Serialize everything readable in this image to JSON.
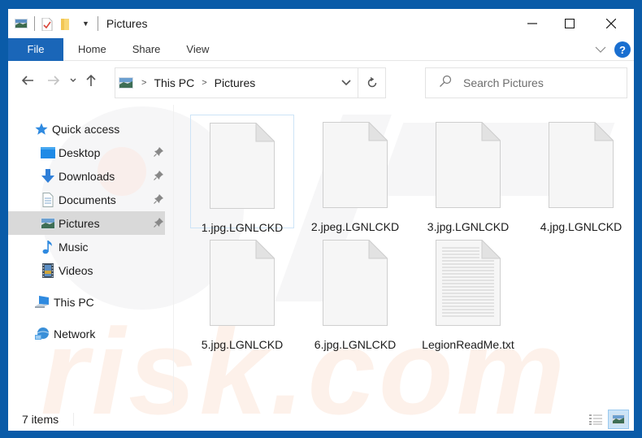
{
  "window": {
    "title": "Pictures",
    "controls": {
      "minimize": "minimize",
      "maximize": "maximize",
      "close": "close"
    }
  },
  "quick_access_toolbar": {
    "icons": [
      "pictures-folder-icon",
      "properties-icon",
      "new-folder-icon",
      "customize-dropdown-icon"
    ]
  },
  "ribbon": {
    "file_label": "File",
    "tabs": [
      "Home",
      "Share",
      "View"
    ],
    "expand_icon": "chevron-down-icon",
    "help_label": "?"
  },
  "navigation": {
    "back_icon": "arrow-left-icon",
    "forward_icon": "arrow-right-icon",
    "recent_icon": "chevron-down-icon",
    "up_icon": "arrow-up-icon",
    "breadcrumb": [
      "This PC",
      "Pictures"
    ],
    "refresh_icon": "refresh-icon"
  },
  "search": {
    "placeholder": "Search Pictures",
    "value": ""
  },
  "sidebar": {
    "quick_access": "Quick access",
    "items": [
      {
        "label": "Desktop",
        "pinned": true
      },
      {
        "label": "Downloads",
        "pinned": true
      },
      {
        "label": "Documents",
        "pinned": true
      },
      {
        "label": "Pictures",
        "pinned": true,
        "selected": true
      },
      {
        "label": "Music",
        "pinned": false
      },
      {
        "label": "Videos",
        "pinned": false
      }
    ],
    "this_pc": "This PC",
    "network": "Network"
  },
  "files": [
    {
      "name": "1.jpg.LGNLCKD",
      "type": "blank"
    },
    {
      "name": "2.jpeg.LGNLCKD",
      "type": "blank"
    },
    {
      "name": "3.jpg.LGNLCKD",
      "type": "blank"
    },
    {
      "name": "4.jpg.LGNLCKD",
      "type": "blank"
    },
    {
      "name": "5.jpg.LGNLCKD",
      "type": "blank"
    },
    {
      "name": "6.jpg.LGNLCKD",
      "type": "blank"
    },
    {
      "name": "LegionReadMe.txt",
      "type": "text"
    }
  ],
  "status": {
    "item_count": "7 items",
    "view_details": "details-view",
    "view_large_icons": "large-icons-view"
  },
  "watermark": "risk.com",
  "colors": {
    "frame": "#0a5ba8",
    "file_tab": "#1a66b8",
    "selected_nav": "#d9d9d9",
    "help": "#1a6fd0"
  }
}
